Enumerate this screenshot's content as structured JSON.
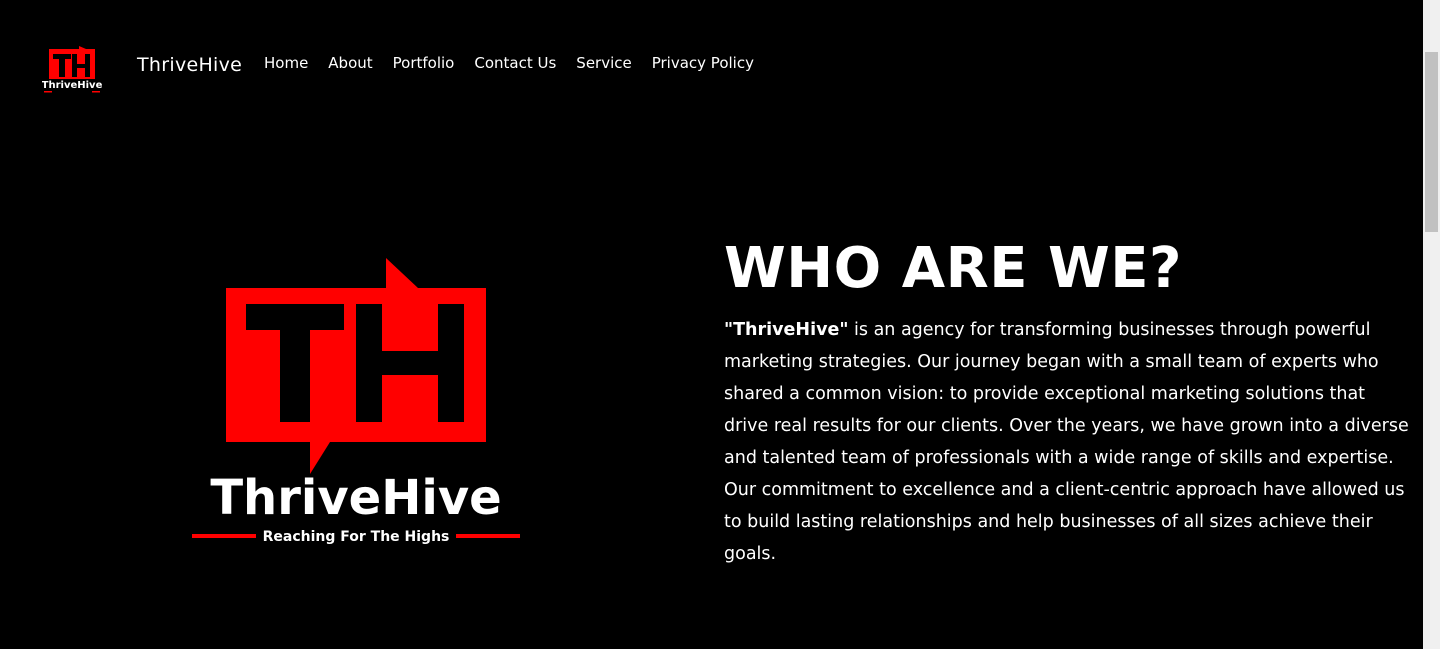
{
  "header": {
    "logo_letters": "TH",
    "logo_name": "ThriveHive",
    "logo_tagline": "Reaching For The Highs",
    "brand": "ThriveHive",
    "nav": [
      "Home",
      "About",
      "Portfolio",
      "Contact Us",
      "Service",
      "Privacy Policy"
    ]
  },
  "hero": {
    "logo_name": "ThriveHive",
    "logo_tagline": "Reaching For The Highs"
  },
  "about": {
    "heading": "WHO ARE WE?",
    "brand_quoted": "\"ThriveHive\"",
    "body": " is an agency for transforming businesses through powerful marketing strategies. Our journey began with a small team of experts who shared a common vision: to provide exceptional marketing solutions that drive real results for our clients. Over the years, we have grown into a diverse and talented team of professionals with a wide range of skills and expertise. Our commitment to excellence and a client-centric approach have allowed us to build lasting relationships and help businesses of all sizes achieve their goals."
  },
  "colors": {
    "brand_red": "#ff0000",
    "background": "#000000",
    "text": "#ffffff"
  }
}
